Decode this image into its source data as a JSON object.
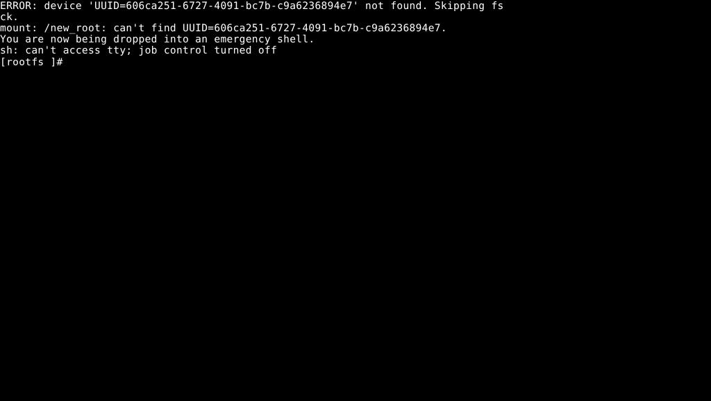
{
  "screen": {
    "type": "linux-console",
    "background_color": "#000000",
    "text_color": "#ffffff",
    "columns": 102,
    "rows": 36
  },
  "console": {
    "lines": [
      "ERROR: device 'UUID=606ca251-6727-4091-bc7b-c9a6236894e7' not found. Skipping fs",
      "ck.",
      "mount: /new_root: can't find UUID=606ca251-6727-4091-bc7b-c9a6236894e7.",
      "You are now being dropped into an emergency shell.",
      "sh: can't access tty; job control turned off"
    ],
    "prompt": "[rootfs ]# ",
    "input_value": ""
  }
}
